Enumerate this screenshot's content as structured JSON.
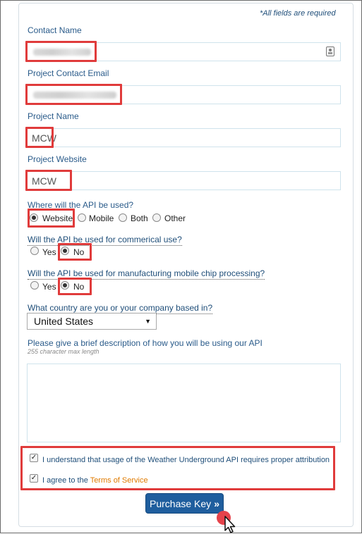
{
  "required_note": "*All fields are required",
  "contact_name": {
    "label": "Contact Name",
    "value": ""
  },
  "contact_email": {
    "label": "Project Contact Email",
    "value": ""
  },
  "project_name": {
    "label": "Project Name",
    "value": "MCW"
  },
  "project_website": {
    "label": "Project Website",
    "value": "MCW"
  },
  "api_usage": {
    "question": "Where will the API be used?",
    "options": [
      "Website",
      "Mobile",
      "Both",
      "Other"
    ],
    "selected": "Website"
  },
  "commercial_use": {
    "question": "Will the API be used for commerical use?",
    "options": [
      "Yes",
      "No"
    ],
    "selected": "No"
  },
  "chip_processing": {
    "question": "Will the API be used for manufacturing mobile chip processing?",
    "options": [
      "Yes",
      "No"
    ],
    "selected": "No"
  },
  "country": {
    "question": "What country are you or your company based in?",
    "selected": "United States"
  },
  "description": {
    "label": "Please give a brief description of how you will be using our API",
    "hint": "255 character max length",
    "value": ""
  },
  "agreements": {
    "attribution": "I understand that usage of the Weather Underground API requires proper attribution",
    "terms_prefix": "I agree to the",
    "terms_link": "Terms of Service",
    "attribution_checked": true,
    "terms_checked": true
  },
  "submit_label": "Purchase Key",
  "colors": {
    "accent": "#1f5e9e",
    "highlight": "#e03b3b",
    "link": "#e07b00"
  }
}
